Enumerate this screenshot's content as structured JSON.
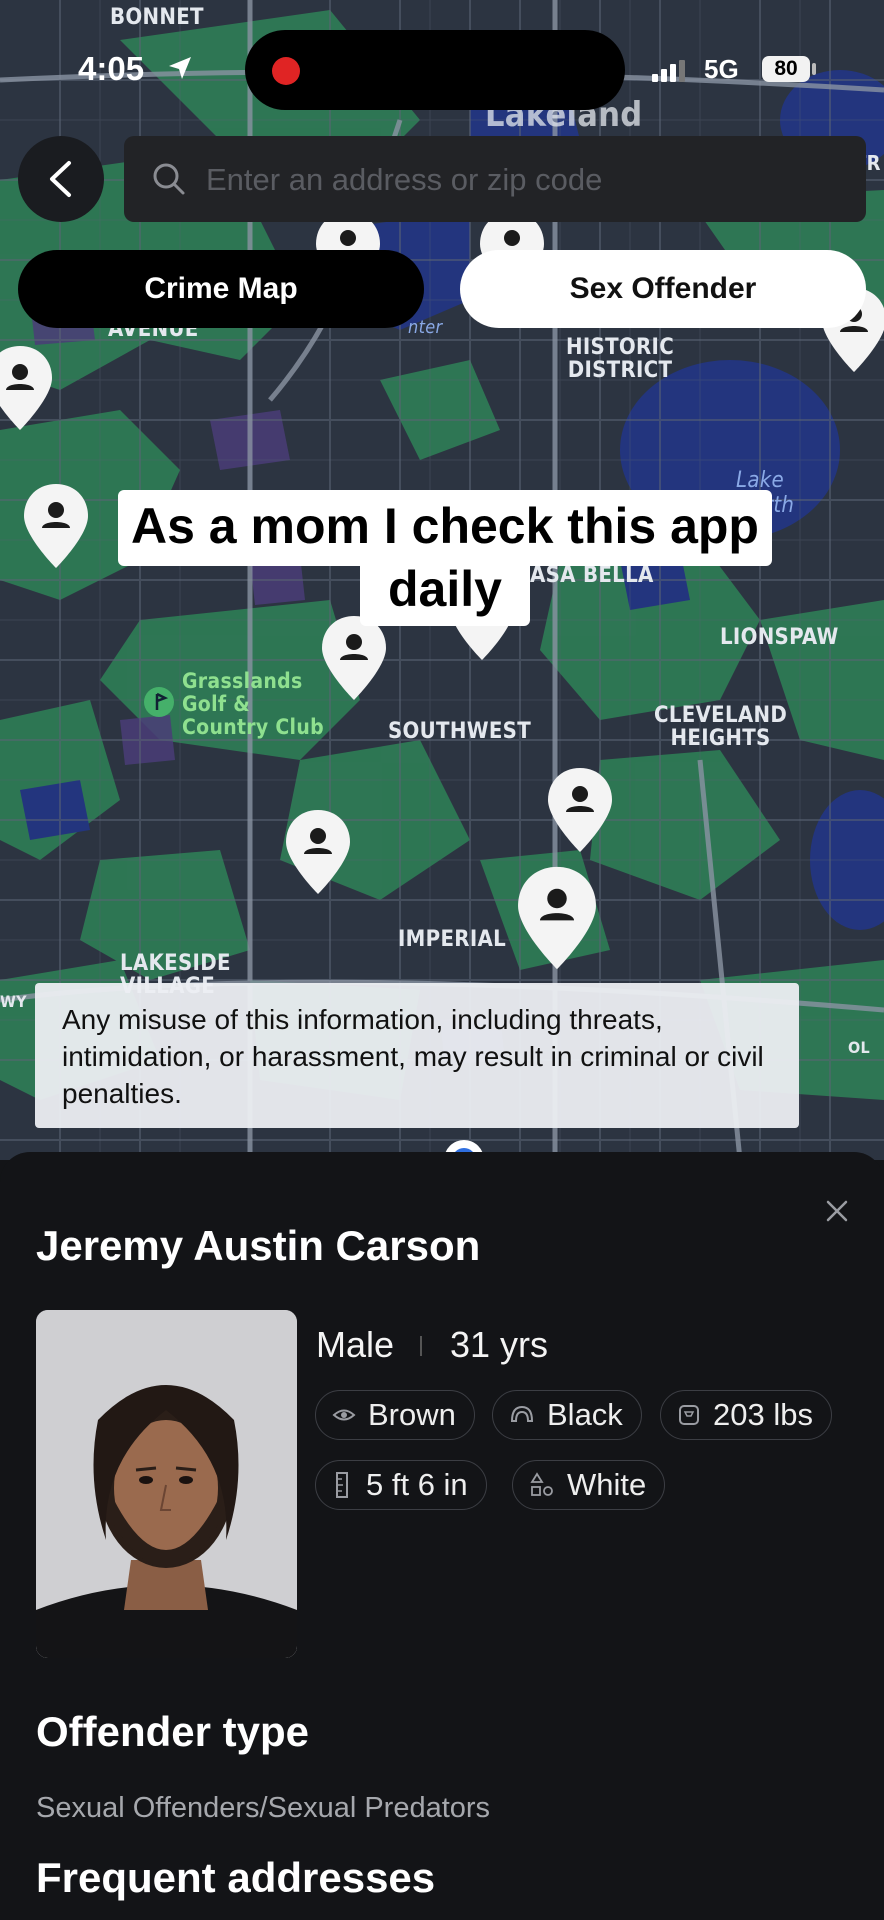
{
  "status_bar": {
    "time": "4:05",
    "network": "5G",
    "battery": "80"
  },
  "search": {
    "placeholder": "Enter an address or zip code"
  },
  "mode_toggle": {
    "crime_map": "Crime Map",
    "sex_offender": "Sex Offender",
    "selected": "Sex Offender"
  },
  "map": {
    "labels": {
      "bonnet": "BONNET",
      "avenue": "AVENUE",
      "historic": "HISTORIC\nDISTRICT",
      "lake_morton": "Lake\nworth",
      "casa_bella": "ASA BELLA",
      "lionspaw": "LIONSPAW",
      "grasslands": "Grasslands\nGolf &\nCountry Club",
      "southwest": "SOUTHWEST",
      "cleveland": "CLEVELAND\nHEIGHTS",
      "imperial": "IMPERIAL",
      "lakeside": "LAKESIDE\nVILLAGE",
      "lakeland": "Lakeland",
      "hunter": "nter",
      "tr": "TR",
      "wy": "WY",
      "ol": "OL"
    }
  },
  "caption": {
    "line1": "As a mom I check this app",
    "line2": "daily"
  },
  "disclaimer": "Any misuse of this information, including threats, intimidation, or harassment, may result in criminal or civil penalties.",
  "offender": {
    "name": "Jeremy Austin Carson",
    "gender": "Male",
    "age": "31 yrs",
    "eye_color": "Brown",
    "hair_color": "Black",
    "weight": "203 lbs",
    "height": "5 ft 6 in",
    "race": "White"
  },
  "offender_type": {
    "title": "Offender type",
    "value": "Sexual Offenders/Sexual Predators"
  },
  "frequent_addresses": {
    "title": "Frequent addresses"
  },
  "colors": {
    "map_bg": "#2c3441",
    "green": "#2e7a55",
    "water": "#23357e",
    "sheet": "#131417"
  },
  "icons": [
    "location-arrow-icon",
    "signal-icon",
    "chevron-left-icon",
    "search-icon",
    "close-icon",
    "eye-icon",
    "hair-icon",
    "scale-icon",
    "ruler-icon",
    "shapes-icon",
    "map-pin-icon",
    "golf-icon"
  ]
}
